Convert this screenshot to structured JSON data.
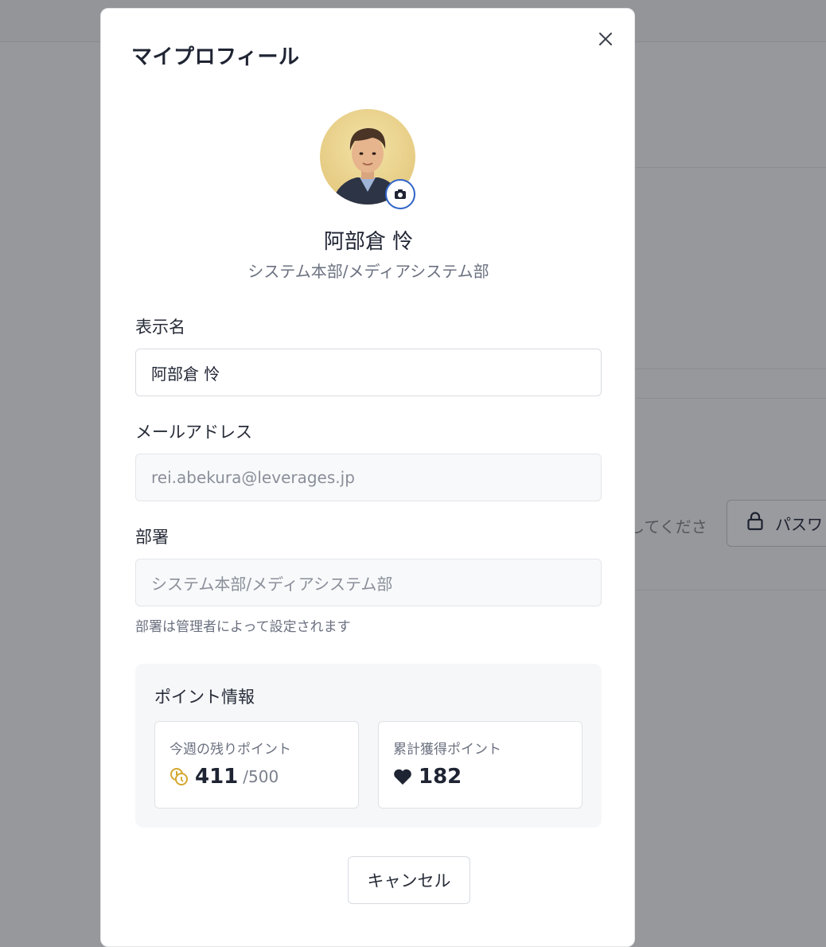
{
  "background": {
    "hint_text": "してくださ",
    "password_button_label": "パスワ"
  },
  "modal": {
    "title": "マイプロフィール",
    "close_icon": "close-icon"
  },
  "profile": {
    "name": "阿部倉 怜",
    "department": "システム本部/メディアシステム部",
    "avatar_edit_icon": "camera-icon"
  },
  "form": {
    "display_name": {
      "label": "表示名",
      "value": "阿部倉 怜"
    },
    "email": {
      "label": "メールアドレス",
      "value": "rei.abekura@leverages.jp"
    },
    "department": {
      "label": "部署",
      "value": "システム本部/メディアシステム部",
      "help": "部署は管理者によって設定されます"
    }
  },
  "points": {
    "title": "ポイント情報",
    "weekly": {
      "label": "今週の残りポイント",
      "value": "411",
      "max": "/500",
      "icon": "coins-icon",
      "icon_color": "#d4a72c"
    },
    "total": {
      "label": "累計獲得ポイント",
      "value": "182",
      "icon": "heart-icon"
    }
  },
  "actions": {
    "cancel_label": "キャンセル"
  },
  "colors": {
    "accent": "#2f64c7",
    "overlay": "#97989b"
  }
}
